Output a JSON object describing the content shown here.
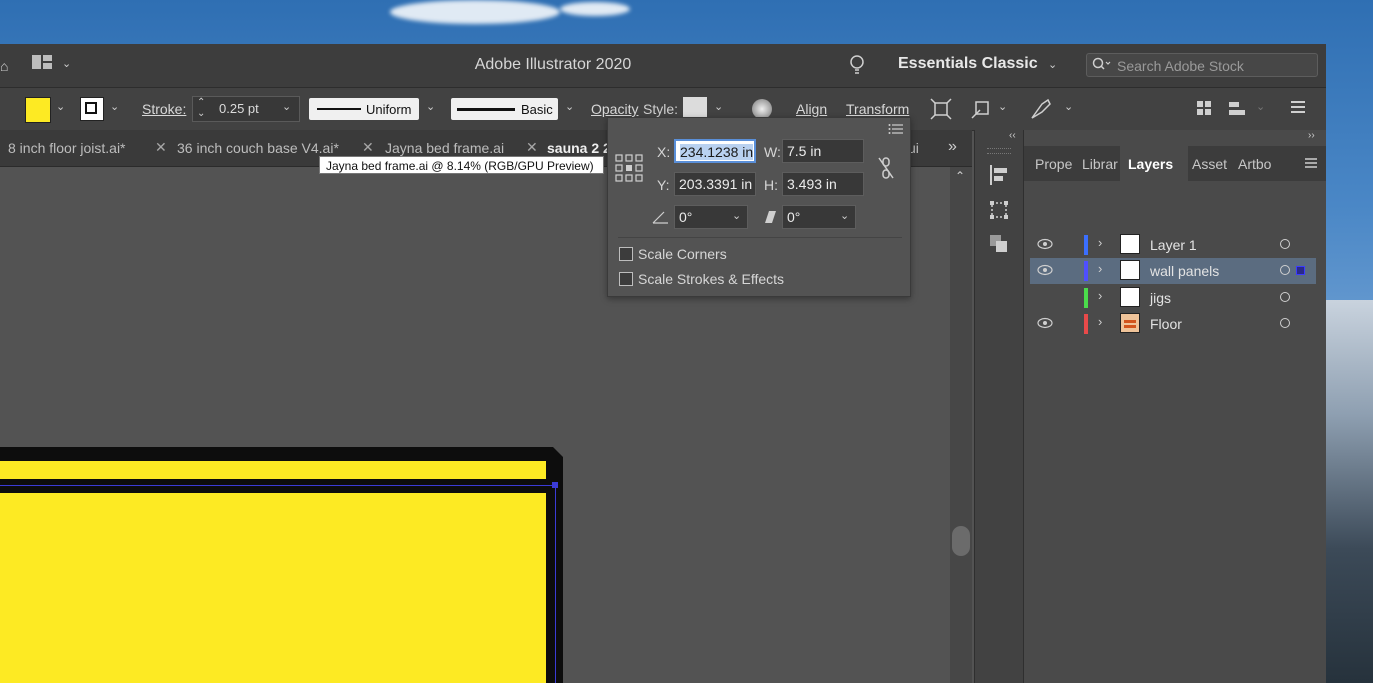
{
  "app": {
    "title": "Adobe Illustrator 2020",
    "workspace": "Essentials Classic",
    "search_placeholder": "Search Adobe Stock"
  },
  "control_bar": {
    "stroke_label": "Stroke:",
    "stroke_value": "0.25 pt",
    "profile": "Uniform",
    "brush": "Basic",
    "opacity_label": "Opacity",
    "style_label": "Style:",
    "align_label": "Align",
    "transform_label": "Transform",
    "fill_color": "#fdea23"
  },
  "tabs": [
    {
      "label": "8 inch floor joist.ai*"
    },
    {
      "label": "36 inch couch base V4.ai*"
    },
    {
      "label": "Jayna bed frame.ai"
    },
    {
      "label": "sauna 2 2"
    },
    {
      "label": "ui"
    }
  ],
  "tooltip": "Jayna bed frame.ai @ 8.14% (RGB/GPU Preview)",
  "transform": {
    "x_label": "X:",
    "x_value": "234.1238 in",
    "y_label": "Y:",
    "y_value": "203.3391 in",
    "w_label": "W:",
    "w_value": "7.5 in",
    "h_label": "H:",
    "h_value": "3.493 in",
    "rotate_value": "0°",
    "shear_value": "0°",
    "scale_corners": "Scale Corners",
    "scale_strokes": "Scale Strokes & Effects"
  },
  "panel": {
    "tabs": [
      "Prope",
      "Librar",
      "Layers",
      "Asset",
      "Artbo"
    ],
    "active_tab": "Layers",
    "layers": [
      {
        "name": "Layer 1",
        "color": "#3b6fff",
        "visible": true
      },
      {
        "name": "wall panels",
        "color": "#4f4fff",
        "visible": true
      },
      {
        "name": "jigs",
        "color": "#4bdc4b",
        "visible": false
      },
      {
        "name": "Floor",
        "color": "#e94a4a",
        "visible": true
      }
    ]
  }
}
